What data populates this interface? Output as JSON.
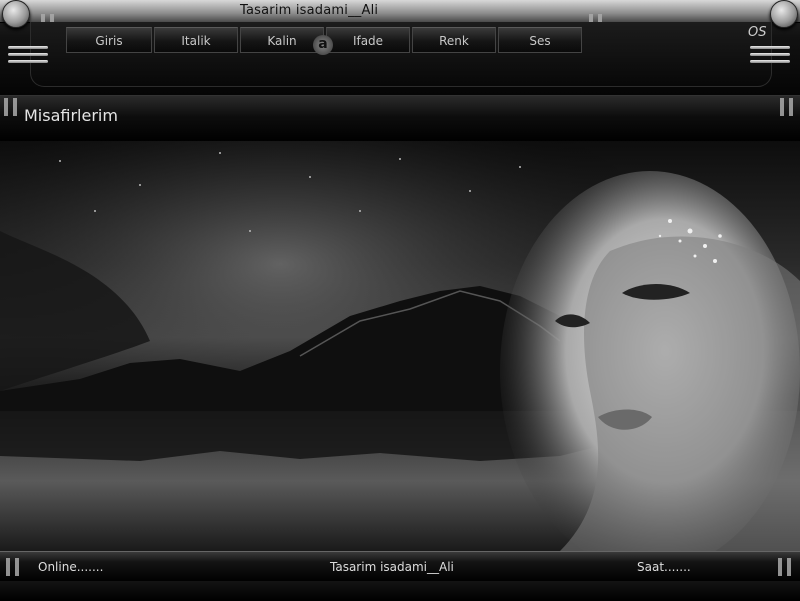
{
  "header": {
    "title": "Tasarim isadami__Ali",
    "logo_letter": "a",
    "corner_mark": "OS"
  },
  "nav": {
    "items": [
      {
        "label": "Giris"
      },
      {
        "label": "Italik"
      },
      {
        "label": "Kalin"
      },
      {
        "label": "Ifade"
      },
      {
        "label": "Renk"
      },
      {
        "label": "Ses"
      }
    ]
  },
  "guests": {
    "title": "Misafirlerim"
  },
  "footer": {
    "online": "Online.......",
    "credit": "Tasarim isadami__Ali",
    "clock": "Saat......."
  },
  "icons": {
    "menu_left": "hamburger-icon",
    "menu_right": "hamburger-icon",
    "knob": "round-knob-icon",
    "grip": "grip-icon"
  },
  "colors": {
    "chrome_light": "#d8d8d8",
    "chrome_dark": "#111111",
    "text": "#dddddd"
  }
}
